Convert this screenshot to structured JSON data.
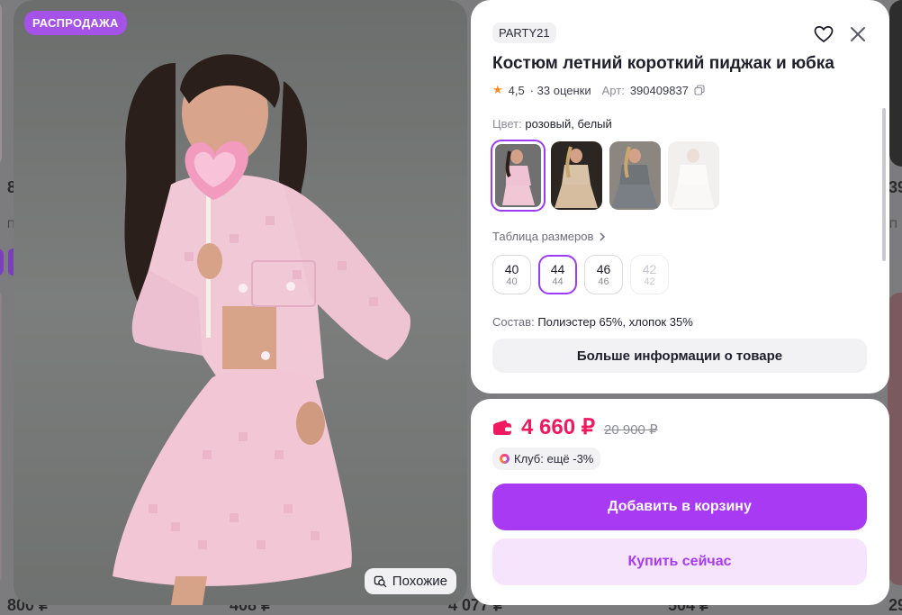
{
  "background": {
    "prices": [
      "8",
      "39",
      "8",
      "29",
      "800 ₽",
      "408 ₽",
      "4 077 ₽",
      "504 ₽",
      "29"
    ],
    "labels": [
      "П",
      "П"
    ]
  },
  "photo": {
    "sale_badge": "РАСПРОДАЖА",
    "similar_label": "Похожие",
    "similar_icon": "similar-search-icon"
  },
  "product": {
    "brand": "PARTY21",
    "title": "Костюм летний короткий пиджак и юбка",
    "rating": "4,5",
    "reviews": "· 33 оценки",
    "article_label": "Арт:",
    "article": "390409837",
    "color_label": "Цвет:",
    "color_value": "розовый, белый",
    "sizes_link": "Таблица размеров",
    "sizes": [
      {
        "main": "40",
        "sub": "40",
        "state": "normal"
      },
      {
        "main": "44",
        "sub": "44",
        "state": "selected"
      },
      {
        "main": "46",
        "sub": "46",
        "state": "normal"
      },
      {
        "main": "42",
        "sub": "42",
        "state": "disabled"
      }
    ],
    "composition_label": "Состав:",
    "composition_value": "Полиэстер 65%, хлопок 35%",
    "more_info": "Больше информации о товаре"
  },
  "purchase": {
    "price": "4 660 ₽",
    "old_price": "20 900 ₽",
    "club": "Клуб: ещё -3%",
    "add_to_cart": "Добавить в корзину",
    "buy_now": "Купить сейчас"
  },
  "colors": {
    "accent": "#a73af2",
    "price": "#f0195f",
    "sale_badge": "#a552e8"
  }
}
